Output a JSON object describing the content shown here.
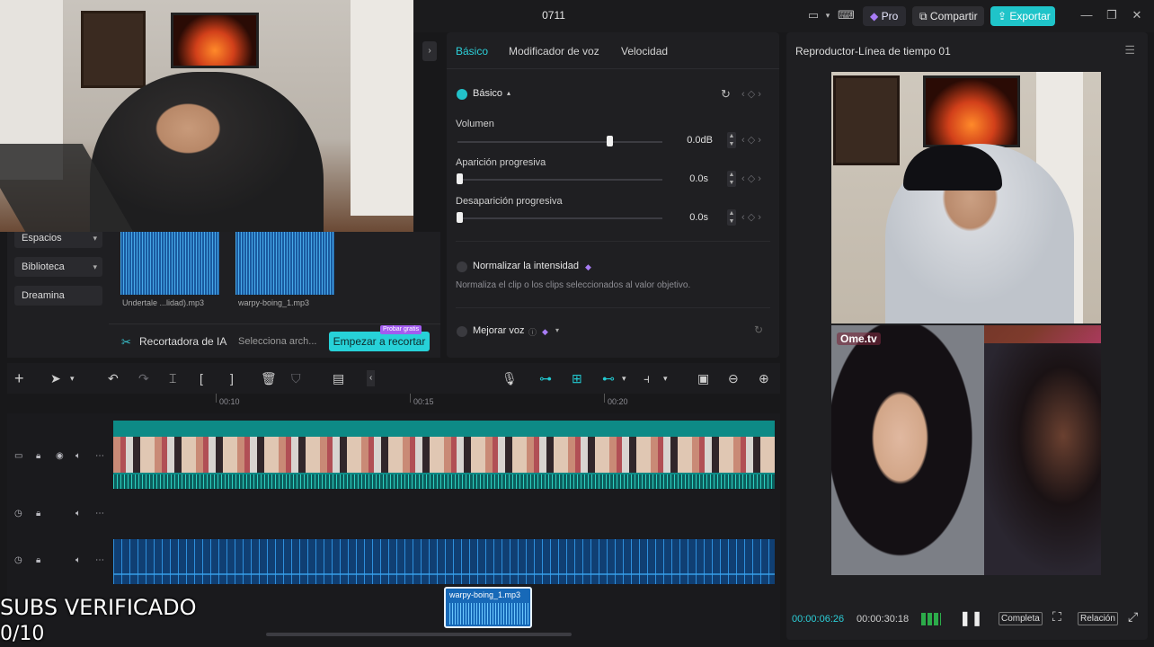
{
  "window": {
    "title": "0711",
    "pro_label": "Pro",
    "share_label": "Compartir",
    "export_label": "Exportar"
  },
  "media": {
    "sidebar": [
      {
        "label": "Espacios",
        "has_chevron": true
      },
      {
        "label": "Biblioteca",
        "has_chevron": true
      },
      {
        "label": "Dreamina",
        "has_chevron": false
      }
    ],
    "clips": [
      {
        "name": "Undertale ...lidad).mp3"
      },
      {
        "name": "warpy-boing_1.mp3"
      }
    ],
    "ai_cutter": {
      "label": "Recortadora de IA",
      "hint": "Selecciona arch...",
      "button": "Empezar a recortar",
      "badge": "Probar gratis"
    }
  },
  "properties": {
    "tabs": [
      "Básico",
      "Modificador de voz",
      "Velocidad"
    ],
    "active_tab": "Básico",
    "section_title": "Básico",
    "volume": {
      "label": "Volumen",
      "value": "0.0dB",
      "level": 0.75
    },
    "fade_in": {
      "label": "Aparición progresiva",
      "value": "0.0s",
      "level": 0
    },
    "fade_out": {
      "label": "Desaparición progresiva",
      "value": "0.0s",
      "level": 0
    },
    "normalize": {
      "label": "Normalizar la intensidad",
      "description": "Normaliza el clip o los clips seleccionados al valor objetivo.",
      "checked": false
    },
    "enhance": {
      "label": "Mejorar voz",
      "checked": false
    }
  },
  "player": {
    "title": "Reproductor-Línea de tiempo 01",
    "current_time": "00:00:06:26",
    "total_time": "00:00:30:18",
    "full_label": "Completa",
    "ratio_label": "Relación",
    "watermark": "Ome.tv"
  },
  "timeline": {
    "ticks": [
      "00:10",
      "00:15",
      "00:20"
    ],
    "sfx_clip": "warpy-boing_1.mp3"
  },
  "overlay": {
    "subs": "SUBS VERIFICADO",
    "count": "0/10"
  },
  "icons": {
    "accent": "#22c1c9",
    "export_bg": "#1fc4c9"
  }
}
